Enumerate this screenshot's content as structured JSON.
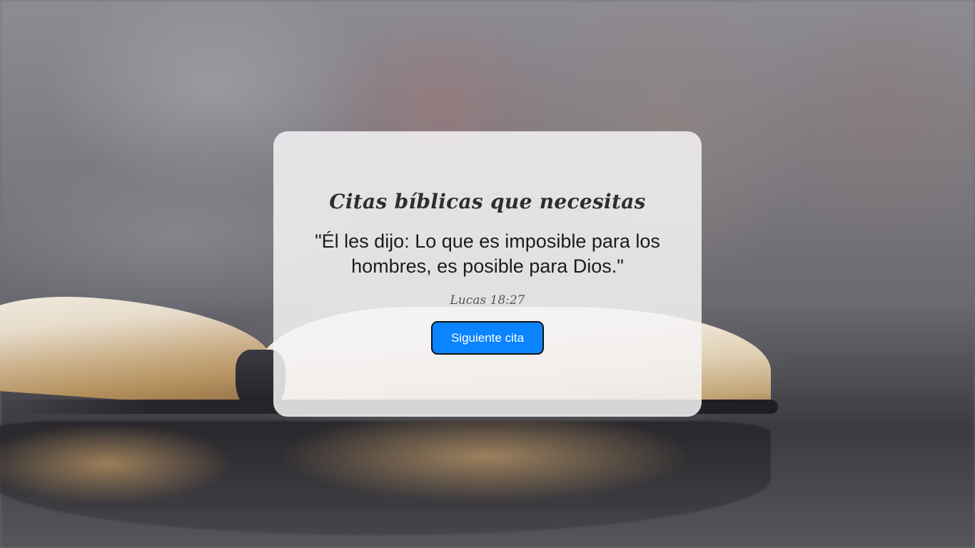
{
  "card": {
    "title": "Citas bíblicas que necesitas",
    "quote": "\"Él les dijo: Lo que es imposible para los hombres, es posible para Dios.\"",
    "reference": "Lucas 18:27",
    "next_button_label": "Siguiente cita"
  },
  "colors": {
    "button_bg": "#0a84ff",
    "card_bg": "#f4f3f5",
    "title_text": "#2e2e2e"
  }
}
